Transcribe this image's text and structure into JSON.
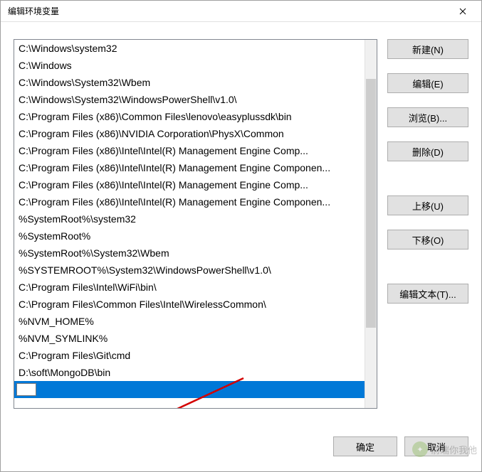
{
  "window": {
    "title": "编辑环境变量"
  },
  "list": {
    "items": [
      "C:\\Windows\\system32",
      "C:\\Windows",
      "C:\\Windows\\System32\\Wbem",
      "C:\\Windows\\System32\\WindowsPowerShell\\v1.0\\",
      "C:\\Program Files (x86)\\Common Files\\lenovo\\easyplussdk\\bin",
      "C:\\Program Files (x86)\\NVIDIA Corporation\\PhysX\\Common",
      "C:\\Program Files (x86)\\Intel\\Intel(R) Management Engine Comp...",
      "C:\\Program Files (x86)\\Intel\\Intel(R) Management Engine Componen...",
      "C:\\Program Files (x86)\\Intel\\Intel(R) Management Engine Comp...",
      "C:\\Program Files (x86)\\Intel\\Intel(R) Management Engine Componen...",
      "%SystemRoot%\\system32",
      "%SystemRoot%",
      "%SystemRoot%\\System32\\Wbem",
      "%SYSTEMROOT%\\System32\\WindowsPowerShell\\v1.0\\",
      "C:\\Program Files\\Intel\\WiFi\\bin\\",
      "C:\\Program Files\\Common Files\\Intel\\WirelessCommon\\",
      "%NVM_HOME%",
      "%NVM_SYMLINK%",
      "C:\\Program Files\\Git\\cmd",
      "D:\\soft\\MongoDB\\bin"
    ],
    "editing_value": ""
  },
  "buttons": {
    "new": "新建(N)",
    "edit": "编辑(E)",
    "browse": "浏览(B)...",
    "delete": "删除(D)",
    "moveup": "上移(U)",
    "movedown": "下移(O)",
    "edittext": "编辑文本(T)...",
    "ok": "确定",
    "cancel": "取消"
  },
  "watermark": {
    "text": "前端你我他"
  }
}
